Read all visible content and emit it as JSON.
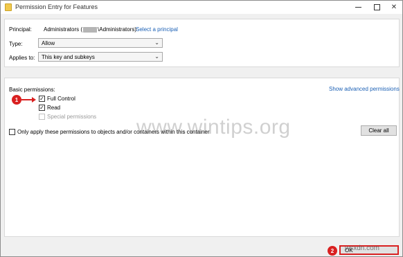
{
  "window": {
    "title": "Permission Entry for Features"
  },
  "principal": {
    "label": "Principal:",
    "value_prefix": "Administrators (",
    "value_suffix": "\\Administrators)",
    "select_link": "Select a principal"
  },
  "type": {
    "label": "Type:",
    "value": "Allow"
  },
  "applies_to": {
    "label": "Applies to:",
    "value": "This key and subkeys"
  },
  "permissions": {
    "heading": "Basic permissions:",
    "show_advanced": "Show advanced permissions",
    "items": [
      {
        "label": "Full Control",
        "checked": true,
        "disabled": false
      },
      {
        "label": "Read",
        "checked": true,
        "disabled": false
      },
      {
        "label": "Special permissions",
        "checked": false,
        "disabled": true
      }
    ],
    "only_apply_label": "Only apply these permissions to objects and/or containers within this container",
    "clear_all": "Clear all"
  },
  "footer": {
    "ok_label": "OK"
  },
  "annotations": {
    "step1": "1",
    "step2": "2",
    "color": "#d92020"
  },
  "watermarks": {
    "main": "www.wintips.org",
    "corner": "wsxdn.com"
  }
}
